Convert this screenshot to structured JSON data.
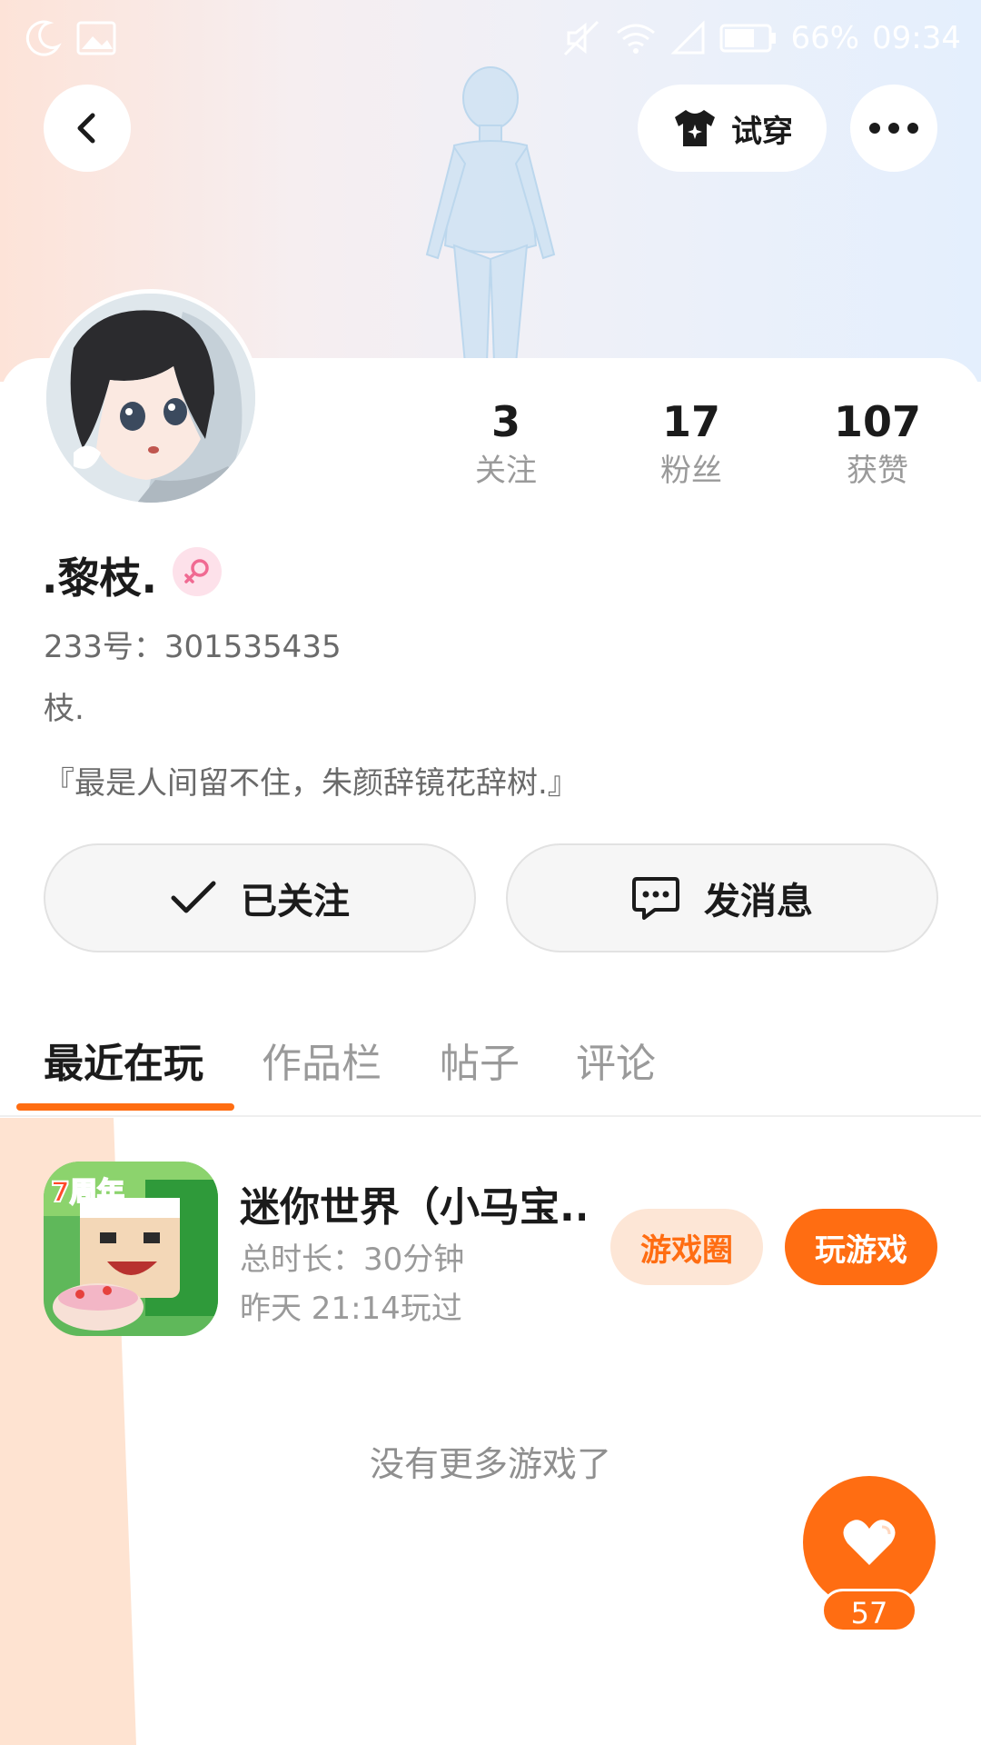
{
  "status_bar": {
    "battery_percent": "66%",
    "time": "09:34",
    "icons": [
      "moon-icon",
      "image-icon",
      "mute-icon",
      "wifi-icon",
      "no-sim-icon",
      "battery-icon"
    ]
  },
  "header": {
    "back_icon": "chevron-left-icon",
    "tryon_label": "试穿",
    "tryon_icon": "tshirt-sparkle-icon",
    "more_icon": "more-dots-icon"
  },
  "profile": {
    "username": ".黎枝.",
    "gender_icon": "female-icon",
    "uid_label": "233号：301535435",
    "signature_line1": "枝.",
    "signature_line2": "『最是人间留不住，朱颜辞镜花辞树.』",
    "stats": [
      {
        "value": "3",
        "label": "关注"
      },
      {
        "value": "17",
        "label": "粉丝"
      },
      {
        "value": "107",
        "label": "获赞"
      }
    ]
  },
  "actions": {
    "followed_label": "已关注",
    "message_label": "发消息"
  },
  "tabs": [
    {
      "label": "最近在玩",
      "active": true
    },
    {
      "label": "作品栏",
      "active": false
    },
    {
      "label": "帖子",
      "active": false
    },
    {
      "label": "评论",
      "active": false
    }
  ],
  "recent_games": [
    {
      "title": "迷你世界（小马宝...",
      "icon_badge": "7周年",
      "total_time": "总时长：30分钟",
      "last_played": "昨天 21:14玩过",
      "circle_label": "游戏圈",
      "play_label": "玩游戏"
    }
  ],
  "empty_hint": "没有更多游戏了",
  "like": {
    "count": "57"
  },
  "colors": {
    "accent": "#ff6d12",
    "accent_soft": "#fde6d6",
    "text_primary": "#1b1b1b",
    "text_secondary": "#9a9a9a"
  }
}
